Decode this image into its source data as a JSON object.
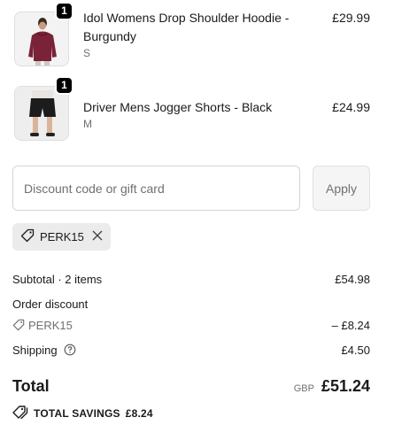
{
  "line_items": [
    {
      "title": "Idol Womens Drop Shoulder Hoodie - Burgundy",
      "variant": "S",
      "quantity": "1",
      "price": "£29.99",
      "image_icon": "hoodie-image"
    },
    {
      "title": "Driver Mens Jogger Shorts - Black",
      "variant": "M",
      "quantity": "1",
      "price": "£24.99",
      "image_icon": "shorts-image"
    }
  ],
  "discount": {
    "placeholder": "Discount code or gift card",
    "apply_label": "Apply",
    "applied_code": "PERK15"
  },
  "summary": {
    "subtotal_label": "Subtotal · 2 items",
    "subtotal_value": "£54.98",
    "order_discount_label": "Order discount",
    "discount_code": "PERK15",
    "discount_value": "– £8.24",
    "shipping_label": "Shipping",
    "shipping_value": "£4.50"
  },
  "total": {
    "label": "Total",
    "currency": "GBP",
    "amount": "£51.24"
  },
  "savings": {
    "label": "TOTAL SAVINGS",
    "amount": "£8.24"
  },
  "colors": {
    "hoodie": "#7a2237",
    "badge": "#000000",
    "tag_bg": "#ebebeb"
  }
}
